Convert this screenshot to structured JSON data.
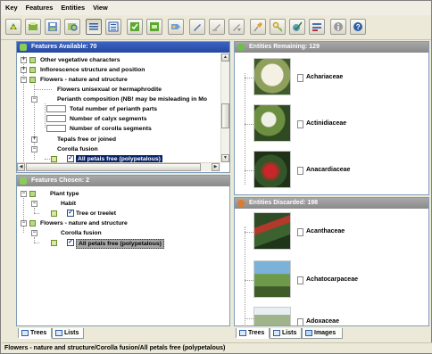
{
  "menubar": {
    "items": [
      "Key",
      "Features",
      "Entities",
      "View"
    ]
  },
  "toolbar": {
    "buttons": [
      "restart-icon",
      "open-key-icon",
      "save-icon",
      "find-icon",
      "list-view-icon",
      "tree-view-icon",
      "features-best-icon",
      "features-separate-icon",
      "diagnose-icon",
      "pencil-icon",
      "omit-icon",
      "sort-icon",
      "pin-icon",
      "key-icon",
      "check-icon",
      "settings-icon",
      "info-icon",
      "help-icon"
    ]
  },
  "features_available": {
    "title": "Features Available: 70",
    "rows": [
      "Other vegetative characters",
      "Inflorescence structure and position",
      "Flowers - nature and structure",
      "Flowers unisexual or hermaphrodite",
      "Perianth composition (NB! may be misleading in Mo",
      "Total number of perianth parts",
      "Number of calyx segments",
      "Number of corolla segments",
      "Tepals free or joined",
      "Corolla fusion",
      "All petals free (polypetalous)"
    ]
  },
  "features_chosen": {
    "title": "Features Chosen: 2",
    "rows": [
      "Plant type",
      "Habit",
      "Tree or treelet",
      "Flowers - nature and structure",
      "Corolla fusion",
      "All petals free (polypetalous)"
    ]
  },
  "left_tabs": [
    "Trees",
    "Lists"
  ],
  "entities_remaining": {
    "title": "Entities Remaining: 129",
    "items": [
      "Achariaceae",
      "Actinidiaceae",
      "Anacardiaceae"
    ]
  },
  "entities_discarded": {
    "title": "Entities Discarded: 198",
    "items": [
      "Acanthaceae",
      "Achatocarpaceae",
      "Adoxaceae"
    ]
  },
  "right_tabs": [
    "Trees",
    "Lists",
    "Images"
  ],
  "status_bar": "Flowers - nature and structure/Corolla fusion/All petals free (polypetalous)",
  "colors": {
    "active_header": "#26479e",
    "inactive_header": "#8a8a8a",
    "selection": "#0a246a"
  }
}
